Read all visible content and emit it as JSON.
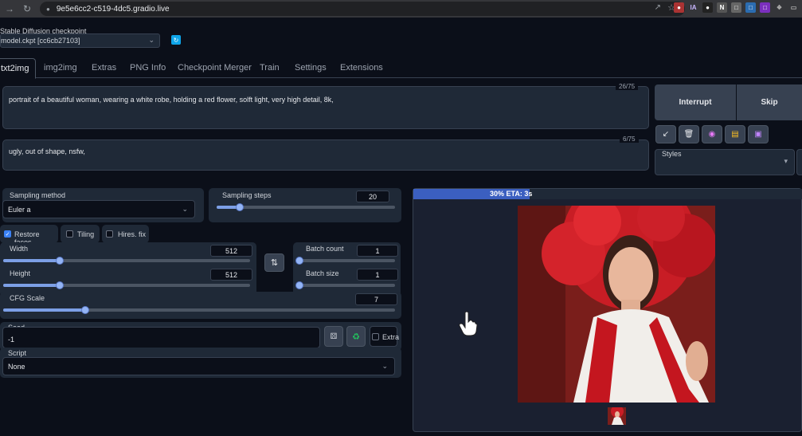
{
  "browser": {
    "url": "9e5e6cc2-c519-4dc5.gradio.live",
    "extension_labels": [
      "IA"
    ]
  },
  "checkpoint": {
    "label": "Stable Diffusion checkpoint",
    "value": "model.ckpt [cc6cb27103]"
  },
  "tabs": [
    {
      "label": "txt2img"
    },
    {
      "label": "img2img"
    },
    {
      "label": "Extras"
    },
    {
      "label": "PNG Info"
    },
    {
      "label": "Checkpoint Merger"
    },
    {
      "label": "Train"
    },
    {
      "label": "Settings"
    },
    {
      "label": "Extensions"
    }
  ],
  "prompt": {
    "text": "portrait of a beautiful woman, wearing a white robe, holding a red flower, solft light, very high detail, 8k,",
    "token_count": "26/75"
  },
  "negative_prompt": {
    "text": "ugly, out of shape, nsfw,",
    "token_count": "6/75"
  },
  "actions": {
    "interrupt": "Interrupt",
    "skip": "Skip"
  },
  "styles": {
    "label": "Styles"
  },
  "sampling": {
    "method_label": "Sampling method",
    "method_value": "Euler a",
    "steps_label": "Sampling steps",
    "steps_value": "20",
    "steps_fraction": 0.13
  },
  "options": {
    "restore_faces": "Restore faces",
    "restore_faces_checked": true,
    "tiling": "Tiling",
    "tiling_checked": false,
    "hires_fix": "Hires. fix",
    "hires_fix_checked": false
  },
  "dimensions": {
    "width_label": "Width",
    "width_value": "512",
    "width_fraction": 0.23,
    "height_label": "Height",
    "height_value": "512",
    "height_fraction": 0.23
  },
  "batch": {
    "count_label": "Batch count",
    "count_value": "1",
    "count_fraction": 0.0,
    "size_label": "Batch size",
    "size_value": "1",
    "size_fraction": 0.0
  },
  "cfg": {
    "label": "CFG Scale",
    "value": "7",
    "fraction": 0.21
  },
  "seed": {
    "label": "Seed",
    "value": "-1",
    "extra_label": "Extra"
  },
  "script": {
    "label": "Script",
    "value": "None"
  },
  "progress": {
    "text": "30% ETA: 3s",
    "percent": 30
  },
  "colors": {
    "background": "#0b0f19",
    "panel": "#1f2937",
    "accent": "#3b5fc0",
    "refresh": "#0ea5e9"
  }
}
